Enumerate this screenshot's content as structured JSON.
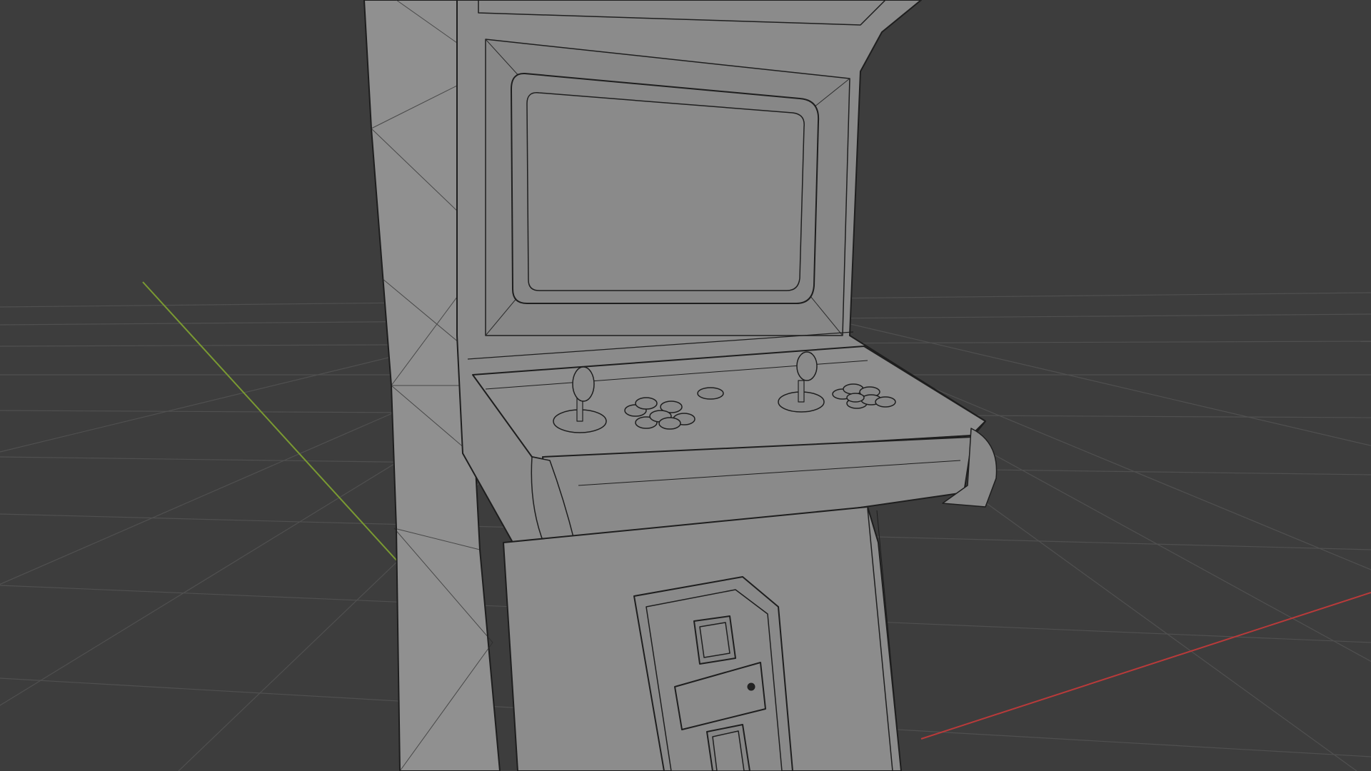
{
  "viewport": {
    "kind": "3d-viewport",
    "background_color": "#3d3d3d",
    "grid_color": "#505050",
    "x_axis_color": "#b83a3a",
    "y_axis_color": "#7a9a32"
  },
  "model": {
    "kind": "arcade-cabinet",
    "shading": "solid-wireframe",
    "surface_color": "#8d8d8d",
    "wire_color": "#1e1e1e",
    "parts": [
      "cabinet-side-panel",
      "cabinet-front",
      "screen-bezel",
      "screen",
      "control-panel",
      "joystick",
      "joystick",
      "arcade-buttons",
      "start-button",
      "coin-door"
    ]
  }
}
